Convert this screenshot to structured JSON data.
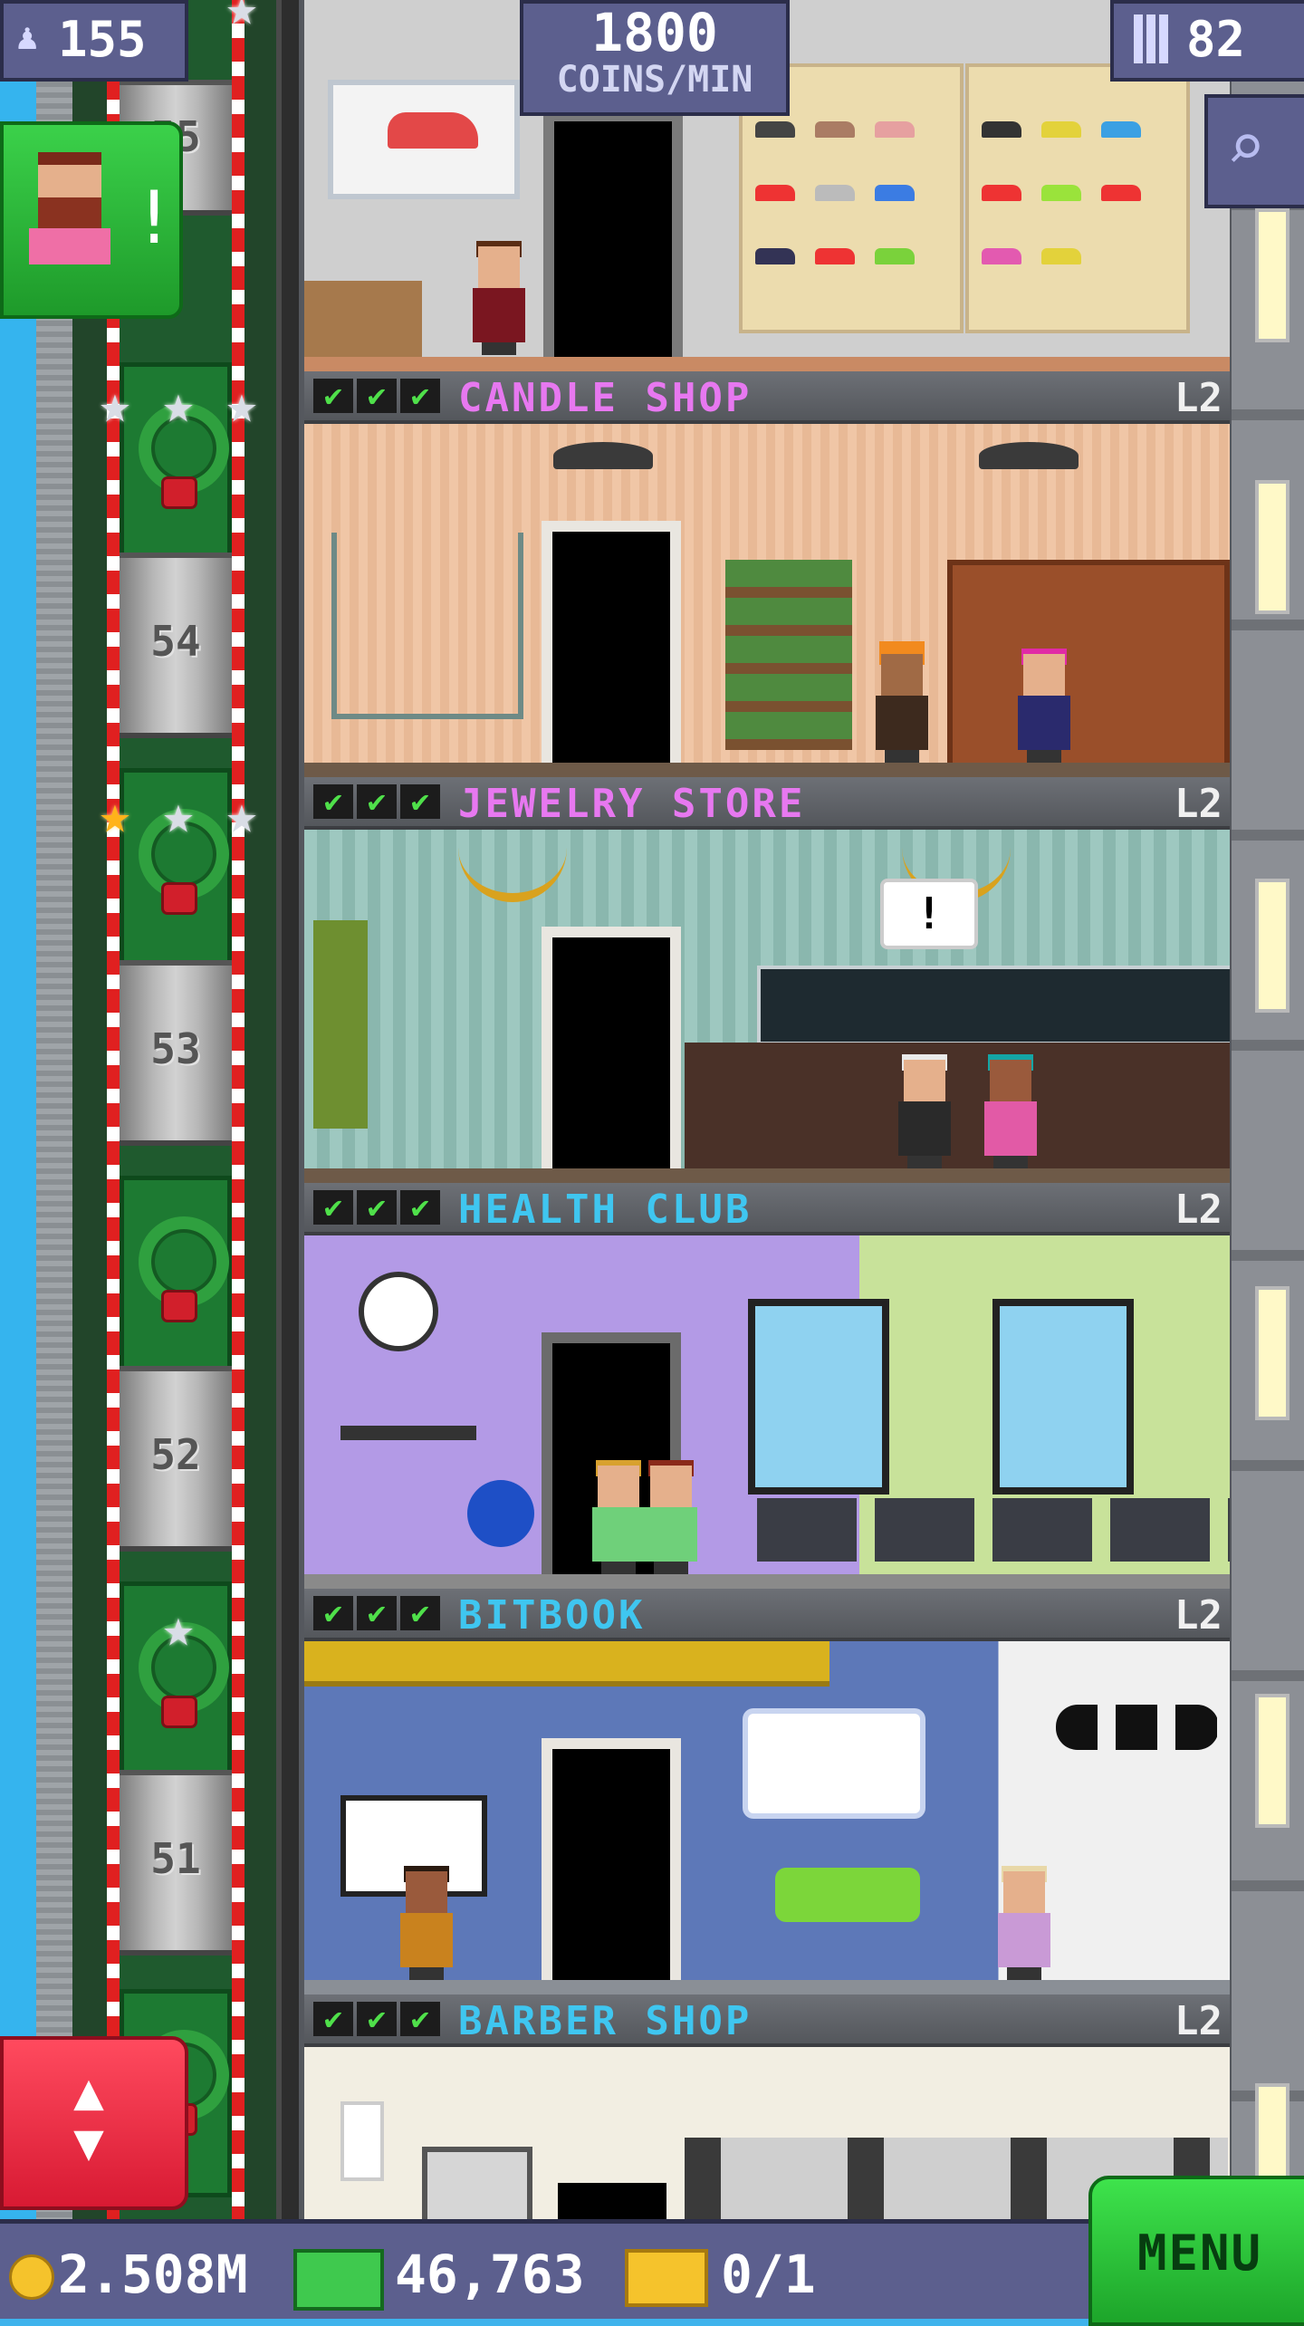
{
  "hud": {
    "population": "155",
    "coins_per_min": "1800",
    "coins_per_min_label": "COINS/MIN",
    "floors": "82"
  },
  "elevator_floor_numbers": [
    "55",
    "54",
    "53",
    "52",
    "51"
  ],
  "floors": [
    {
      "name": "CANDLE SHOP",
      "level": "L2",
      "name_color": "#e778f0"
    },
    {
      "name": "JEWELRY STORE",
      "level": "L2",
      "name_color": "#e778f0"
    },
    {
      "name": "HEALTH CLUB",
      "level": "L2",
      "name_color": "#3fc6f0"
    },
    {
      "name": "BITBOOK",
      "level": "L2",
      "name_color": "#3fc6f0"
    },
    {
      "name": "BARBER SHOP",
      "level": "L2",
      "name_color": "#3fc6f0"
    }
  ],
  "bubbles": {
    "jewelry_alert": "!"
  },
  "visitor": {
    "alert": "!"
  },
  "bottom_bar": {
    "coins": "2.508M",
    "bux": "46,763",
    "tickets": "0/1",
    "menu_label": "MENU"
  },
  "icons": [
    "person-icon",
    "building-icon",
    "magnifier-icon",
    "coin-icon",
    "bux-icon",
    "ticket-icon",
    "elevator-arrows-icon",
    "check-icon",
    "star-icon",
    "wreath-icon"
  ],
  "colors": {
    "hud": "#5c5f8e",
    "menu": "#2fcf3e",
    "elevator_button": "#e8283f",
    "check": "#4fe04a"
  }
}
